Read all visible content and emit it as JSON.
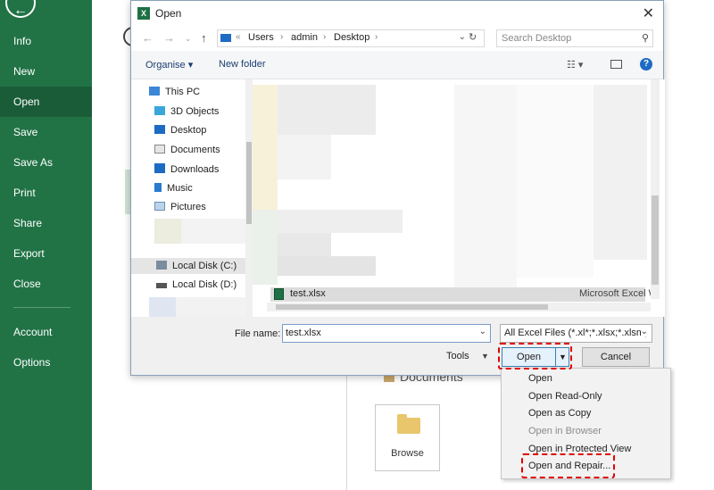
{
  "sidebar": {
    "items": [
      {
        "label": "Info"
      },
      {
        "label": "New"
      },
      {
        "label": "Open"
      },
      {
        "label": "Save"
      },
      {
        "label": "Save As"
      },
      {
        "label": "Print"
      },
      {
        "label": "Share"
      },
      {
        "label": "Export"
      },
      {
        "label": "Close"
      },
      {
        "label": "Account"
      },
      {
        "label": "Options"
      }
    ],
    "active": "Open",
    "bg_color": "#217346"
  },
  "backstage": {
    "documents_label": "Documents",
    "browse_label": "Browse"
  },
  "dialog": {
    "title": "Open",
    "breadcrumb": {
      "prefix": "«",
      "items": [
        "Users",
        "admin",
        "Desktop"
      ]
    },
    "search_placeholder": "Search Desktop",
    "toolbar": {
      "organise": "Organise",
      "new_folder": "New folder"
    },
    "nav_tree": [
      {
        "label": "This PC",
        "icon": "computer-icon"
      },
      {
        "label": "3D Objects",
        "icon": "cube-icon"
      },
      {
        "label": "Desktop",
        "icon": "desktop-icon"
      },
      {
        "label": "Documents",
        "icon": "document-icon"
      },
      {
        "label": "Downloads",
        "icon": "download-icon"
      },
      {
        "label": "Music",
        "icon": "music-icon"
      },
      {
        "label": "Pictures",
        "icon": "picture-icon"
      },
      {
        "label": "Local Disk (C:)",
        "icon": "drive-icon"
      },
      {
        "label": "Local Disk (D:)",
        "icon": "drive-icon"
      }
    ],
    "file": {
      "name": "test.xlsx",
      "type": "Microsoft Excel W"
    },
    "filename_label": "File name:",
    "filename_value": "test.xlsx",
    "filetype_value": "All Excel Files (*.xl*;*.xlsx;*.xlsm;",
    "tools_label": "Tools",
    "open_label": "Open",
    "cancel_label": "Cancel"
  },
  "open_menu": {
    "items": [
      {
        "label": "Open",
        "disabled": false
      },
      {
        "label": "Open Read-Only",
        "disabled": false
      },
      {
        "label": "Open as Copy",
        "disabled": false
      },
      {
        "label": "Open in Browser",
        "disabled": true
      },
      {
        "label": "Open in Protected View",
        "disabled": false
      },
      {
        "label": "Open and Repair...",
        "disabled": false
      }
    ]
  },
  "highlight_color": "#e00000"
}
